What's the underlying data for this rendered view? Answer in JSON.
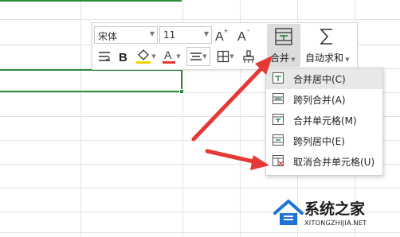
{
  "toolbar": {
    "font_name": "宋体",
    "font_size": "11",
    "merge_label": "合并",
    "autosum_label": "自动求和"
  },
  "merge_menu": {
    "items": [
      {
        "label": "合并居中(C)",
        "icon": "merge-center-icon"
      },
      {
        "label": "跨列合并(A)",
        "icon": "merge-across-icon"
      },
      {
        "label": "合并单元格(M)",
        "icon": "merge-cells-icon"
      },
      {
        "label": "跨列居中(E)",
        "icon": "center-across-icon"
      },
      {
        "label": "取消合并单元格(U)",
        "icon": "unmerge-cells-icon"
      }
    ]
  },
  "watermark": {
    "main": "系统之家",
    "sub": "XITONGZHIJIA.NET"
  },
  "colors": {
    "selection_border": "#2e8b3d",
    "arrow": "#e53935",
    "highlight_bg": "#dcdcdc",
    "font_color_bar": "#e53935",
    "fill_color_bar": "#f5d000",
    "watermark_blue": "#1e73d8"
  }
}
